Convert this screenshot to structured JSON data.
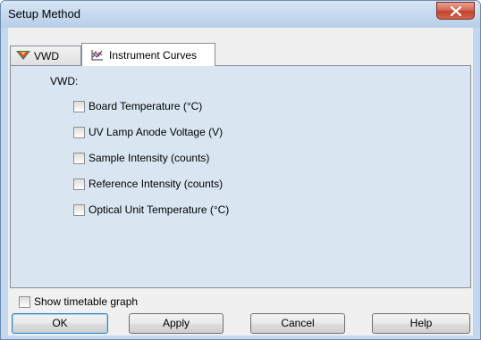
{
  "window": {
    "title": "Setup Method",
    "close_icon": "close-icon"
  },
  "tabs": [
    {
      "label": "VWD",
      "icon": "vwd-detector-icon",
      "active": false
    },
    {
      "label": "Instrument Curves",
      "icon": "curves-icon",
      "active": true
    }
  ],
  "panel": {
    "group_label": "VWD:",
    "curves": [
      {
        "label": "Board Temperature (°C)",
        "checked": false
      },
      {
        "label": "UV Lamp Anode Voltage (V)",
        "checked": false
      },
      {
        "label": "Sample Intensity (counts)",
        "checked": false
      },
      {
        "label": "Reference Intensity (counts)",
        "checked": false
      },
      {
        "label": "Optical Unit Temperature (°C)",
        "checked": false
      }
    ]
  },
  "show_timetable": {
    "label": "Show timetable graph",
    "checked": false
  },
  "buttons": {
    "ok": "OK",
    "apply": "Apply",
    "cancel": "Cancel",
    "help": "Help"
  },
  "colors": {
    "title_bar": "#c6d9ee",
    "panel_bg": "#d9e6f2",
    "close_red": "#c2422b"
  }
}
